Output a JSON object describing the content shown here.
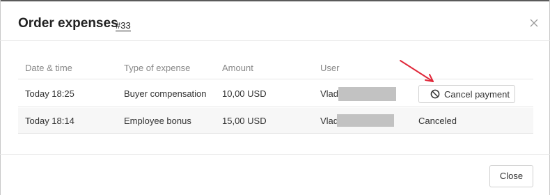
{
  "modal": {
    "title": "Order expenses",
    "order_number": "#33"
  },
  "table": {
    "columns": [
      "Date & time",
      "Type of expense",
      "Amount",
      "User"
    ],
    "rows": [
      {
        "datetime": "Today 18:25",
        "type": "Buyer compensation",
        "amount": "10,00 USD",
        "user": "Vladi",
        "action": "Cancel payment"
      },
      {
        "datetime": "Today 18:14",
        "type": "Employee bonus",
        "amount": "15,00 USD",
        "user": "Vlad",
        "status": "Canceled"
      }
    ]
  },
  "footer": {
    "close_label": "Close"
  },
  "colors": {
    "annotation_arrow": "#e0283a",
    "redaction": "#c2c2c2",
    "alt_row": "#f7f7f7"
  },
  "icons": [
    "close-icon",
    "ban-icon"
  ]
}
